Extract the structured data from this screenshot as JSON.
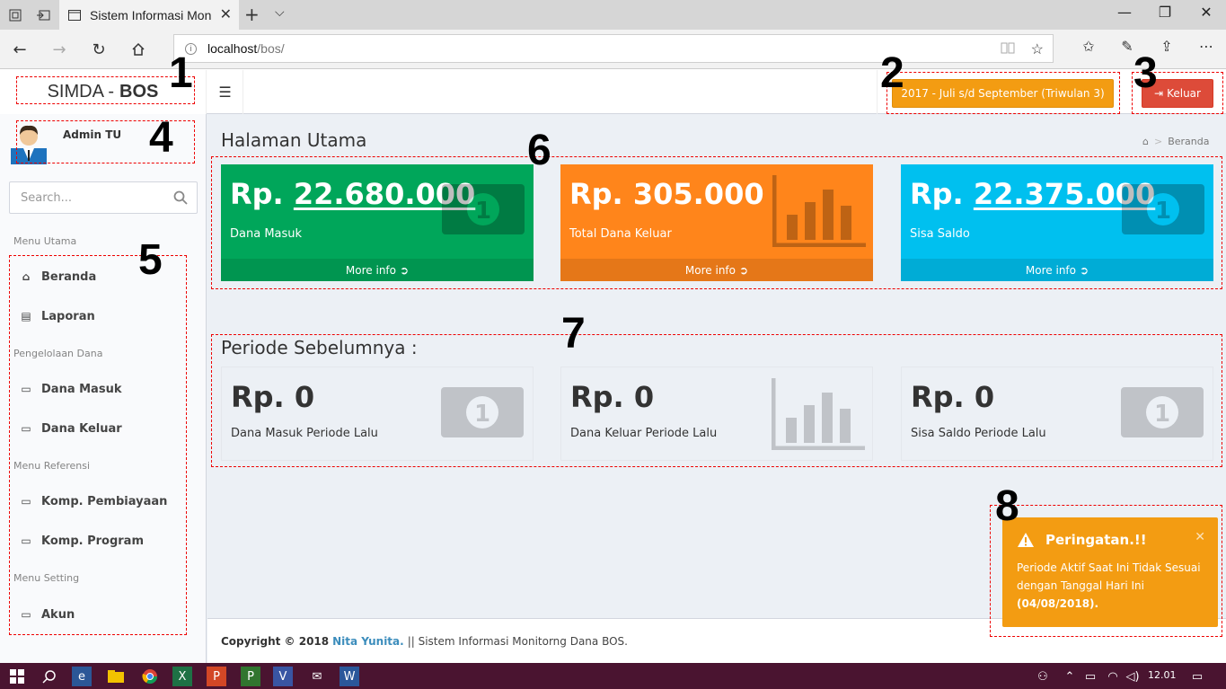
{
  "browser": {
    "tab_title": "Sistem Informasi Monito",
    "url_host": "localhost",
    "url_path": "/bos/"
  },
  "app": {
    "logo_prefix": "SIMDA -",
    "logo_bold": "BOS",
    "periode_label": "2017 - Juli s/d September (Triwulan 3)",
    "logout_label": "Keluar",
    "user_name": "Admin TU",
    "search_placeholder": "Search..."
  },
  "markers": [
    "1",
    "2",
    "3",
    "4",
    "5",
    "6",
    "7",
    "8"
  ],
  "sidebar": {
    "headers": [
      "Menu Utama",
      "Pengelolaan Dana",
      "Menu Referensi",
      "Menu Setting"
    ],
    "items": [
      {
        "label": "Beranda",
        "icon": "home-icon"
      },
      {
        "label": "Laporan",
        "icon": "book-icon"
      },
      {
        "label": "Dana Masuk",
        "icon": "folder-icon"
      },
      {
        "label": "Dana Keluar",
        "icon": "folder-icon"
      },
      {
        "label": "Komp. Pembiayaan",
        "icon": "folder-icon"
      },
      {
        "label": "Komp. Program",
        "icon": "folder-icon"
      },
      {
        "label": "Akun",
        "icon": "folder-icon"
      }
    ]
  },
  "content": {
    "title": "Halaman Utama",
    "breadcrumb": "Beranda",
    "boxes": [
      {
        "prefix": "Rp.",
        "value": "22.680.000",
        "label": "Dana Masuk",
        "footer": "More info",
        "color": "#00a65a"
      },
      {
        "prefix": "Rp.",
        "value": "305.000",
        "label": "Total Dana Keluar",
        "footer": "More info",
        "color": "#ff851b"
      },
      {
        "prefix": "Rp.",
        "value": "22.375.000",
        "label": "Sisa Saldo",
        "footer": "More info",
        "color": "#00c0ef"
      }
    ],
    "prev_title": "Periode Sebelumnya :",
    "prev_boxes": [
      {
        "value": "Rp. 0",
        "label": "Dana Masuk Periode Lalu"
      },
      {
        "value": "Rp. 0",
        "label": "Dana Keluar Periode Lalu"
      },
      {
        "value": "Rp. 0",
        "label": "Sisa Saldo Periode Lalu"
      }
    ]
  },
  "footer": {
    "copyright": "Copyright © 2018",
    "author": "Nita Yunita.",
    "text": "|| Sistem Informasi Monitorng Dana BOS."
  },
  "alert": {
    "title": "Peringatan.!!",
    "message": "Periode Aktif Saat Ini Tidak Sesuai dengan Tanggal Hari Ini",
    "date": "(04/08/2018)."
  },
  "taskbar": {
    "time": "12.01"
  }
}
